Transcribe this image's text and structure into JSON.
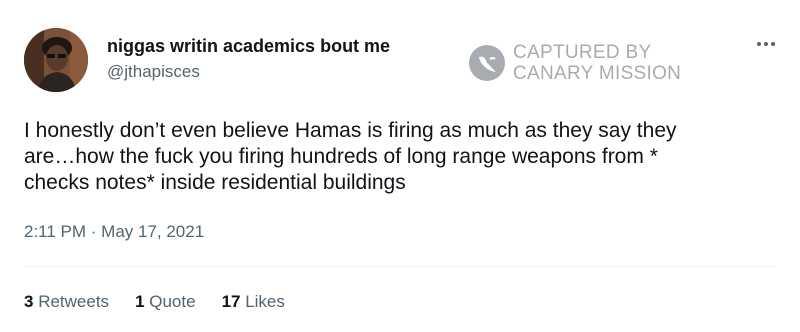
{
  "user": {
    "display_name": "niggas writin academics bout me",
    "handle": "@jthapisces"
  },
  "watermark": {
    "line1": "CAPTURED BY",
    "line2": "CANARY MISSION"
  },
  "tweet": {
    "lines": [
      "I honestly don’t even believe Hamas is firing as much as they say they",
      "are…how the fuck you firing hundreds of long range weapons from *",
      "checks notes* inside residential buildings"
    ],
    "timestamp": "2:11 PM · May 17, 2021"
  },
  "stats": {
    "retweets_count": "3",
    "retweets_label": "Retweets",
    "quotes_count": "1",
    "quotes_label": "Quote",
    "likes_count": "17",
    "likes_label": "Likes"
  },
  "icons": {
    "more": "more-horizontal-icon",
    "watermark": "canary-logo-icon"
  },
  "colors": {
    "text_primary": "#0f1419",
    "text_secondary": "#536471",
    "watermark": "#a8acb0",
    "divider": "#eff3f4"
  }
}
